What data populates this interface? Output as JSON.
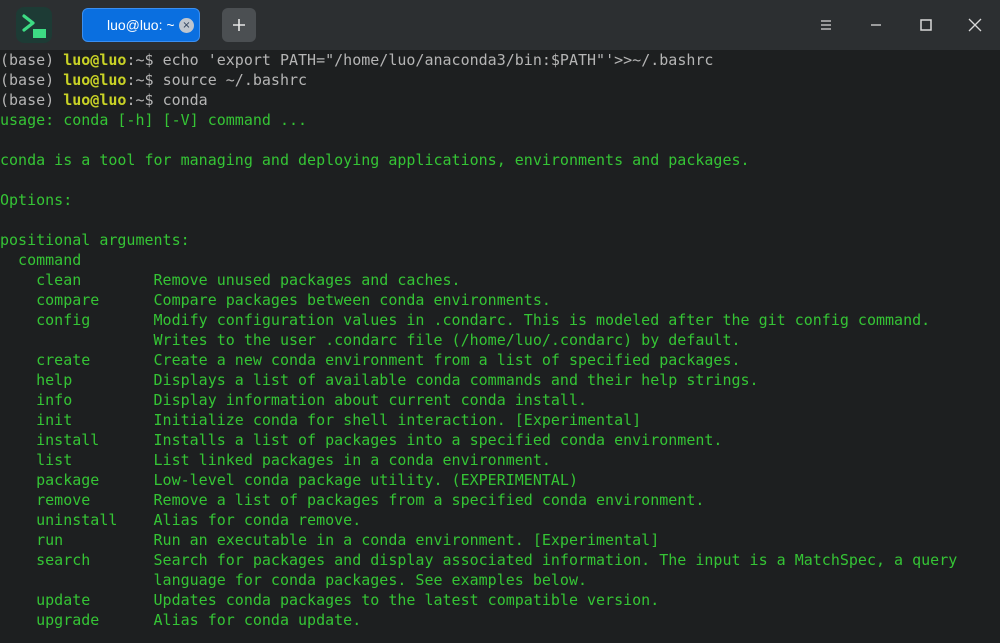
{
  "tab": {
    "label": "luo@luo: ~",
    "close_glyph": "×"
  },
  "new_tab_icon": "plus-icon",
  "window_controls": [
    "menu-icon",
    "minimize-icon",
    "maximize-icon",
    "close-icon"
  ],
  "colors": {
    "output_green": "#35c435",
    "user_yellow": "#c8d226",
    "tab_blue": "#0a6fe0"
  },
  "prompts": [
    {
      "env": "(base)",
      "user": "luo@luo",
      "sep": ":",
      "path": "~",
      "symbol": "$",
      "command": "echo 'export PATH=\"/home/luo/anaconda3/bin:$PATH\"'>>~/.bashrc"
    },
    {
      "env": "(base)",
      "user": "luo@luo",
      "sep": ":",
      "path": "~",
      "symbol": "$",
      "command": "source ~/.bashrc"
    },
    {
      "env": "(base)",
      "user": "luo@luo",
      "sep": ":",
      "path": "~",
      "symbol": "$",
      "command": "conda"
    }
  ],
  "output": [
    "usage: conda [-h] [-V] command ...",
    "",
    "conda is a tool for managing and deploying applications, environments and packages.",
    "",
    "Options:",
    "",
    "positional arguments:",
    "  command",
    "    clean        Remove unused packages and caches.",
    "    compare      Compare packages between conda environments.",
    "    config       Modify configuration values in .condarc. This is modeled after the git config command.",
    "                 Writes to the user .condarc file (/home/luo/.condarc) by default.",
    "    create       Create a new conda environment from a list of specified packages.",
    "    help         Displays a list of available conda commands and their help strings.",
    "    info         Display information about current conda install.",
    "    init         Initialize conda for shell interaction. [Experimental]",
    "    install      Installs a list of packages into a specified conda environment.",
    "    list         List linked packages in a conda environment.",
    "    package      Low-level conda package utility. (EXPERIMENTAL)",
    "    remove       Remove a list of packages from a specified conda environment.",
    "    uninstall    Alias for conda remove.",
    "    run          Run an executable in a conda environment. [Experimental]",
    "    search       Search for packages and display associated information. The input is a MatchSpec, a query",
    "                 language for conda packages. See examples below.",
    "    update       Updates conda packages to the latest compatible version.",
    "    upgrade      Alias for conda update."
  ]
}
